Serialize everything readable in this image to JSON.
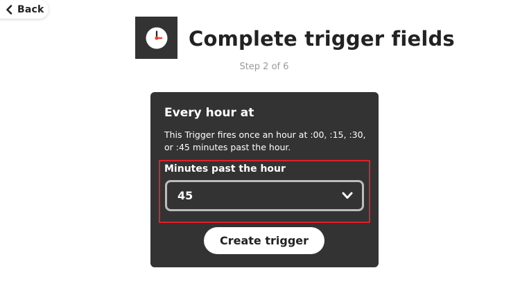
{
  "nav": {
    "back_label": "Back",
    "back_icon": "chevron-left-icon"
  },
  "header": {
    "service_icon": "clock-icon",
    "title": "Complete trigger fields",
    "step": "Step 2 of 6"
  },
  "trigger": {
    "title": "Every hour at",
    "description": "This Trigger fires once an hour at :00, :15, :30, or :45 minutes past the hour.",
    "field": {
      "label": "Minutes past the hour",
      "value": "45",
      "icon": "chevron-down-icon"
    },
    "submit_label": "Create trigger"
  },
  "colors": {
    "card_background": "#333333",
    "highlight": "#e0202a",
    "clock_hand": "#e8452c",
    "text_dark": "#222222",
    "text_muted": "#999999"
  }
}
